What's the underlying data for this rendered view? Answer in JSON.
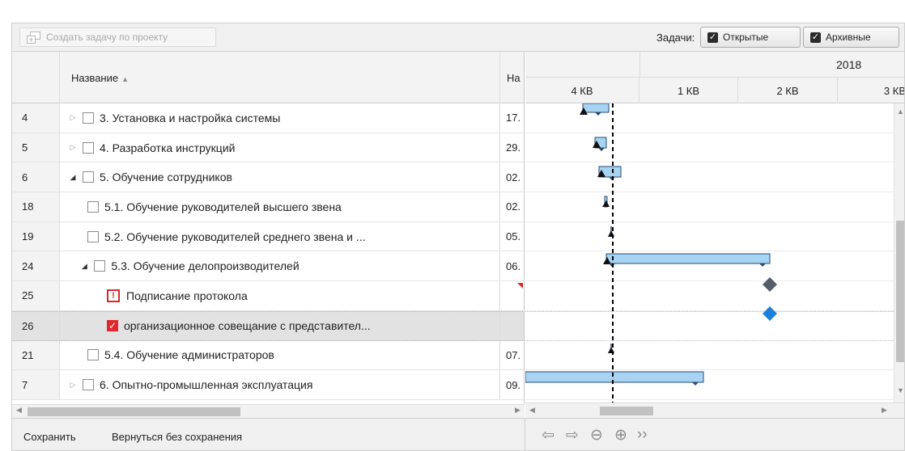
{
  "toolbar": {
    "create_task_label": "Создать задачу по проекту",
    "tasks_label": "Задачи:",
    "open_label": "Открытые",
    "archive_label": "Архивные"
  },
  "grid": {
    "columns": {
      "name": "Название",
      "start": "На"
    },
    "rows": [
      {
        "num": "4",
        "indent": 1,
        "toggle": "collapsed",
        "marker": "checkbox",
        "name": "3. Установка и настройка системы",
        "start": "17."
      },
      {
        "num": "5",
        "indent": 1,
        "toggle": "collapsed",
        "marker": "checkbox",
        "name": "4. Разработка инструкций",
        "start": "29."
      },
      {
        "num": "6",
        "indent": 1,
        "toggle": "expanded",
        "marker": "checkbox",
        "name": "5. Обучение сотрудников",
        "start": "02."
      },
      {
        "num": "18",
        "indent": 2,
        "toggle": "none",
        "marker": "checkbox",
        "name": "5.1. Обучение руководителей высшего звена",
        "start": "02."
      },
      {
        "num": "19",
        "indent": 2,
        "toggle": "none",
        "marker": "checkbox",
        "name": "5.2. Обучение руководителей среднего звена и ...",
        "start": "05."
      },
      {
        "num": "24",
        "indent": 1.6,
        "toggle": "expanded",
        "marker": "checkbox",
        "name": "5.3. Обучение делопроизводителей",
        "start": "06."
      },
      {
        "num": "25",
        "indent": 3,
        "toggle": "none",
        "marker": "warning",
        "name": "Подписание протокола",
        "start": "",
        "flag": true
      },
      {
        "num": "26",
        "indent": 3,
        "toggle": "none",
        "marker": "checked",
        "name": "организационное совещание с представител...",
        "start": "",
        "selected": true
      },
      {
        "num": "21",
        "indent": 2,
        "toggle": "none",
        "marker": "checkbox",
        "name": "5.4. Обучение администраторов",
        "start": "07."
      },
      {
        "num": "7",
        "indent": 1,
        "toggle": "collapsed",
        "marker": "checkbox",
        "name": "6. Опытно-промышленная эксплуатация",
        "start": "09."
      }
    ]
  },
  "gantt": {
    "year": "2018",
    "quarters": [
      "4 КВ",
      "1 КВ",
      "2 КВ",
      "3 КВ"
    ],
    "colors": {
      "bar_fill": "#a6d4f2",
      "bar_stroke": "#2b4a73",
      "milestone": "#555d6b",
      "milestone_selected": "#1b80d6",
      "today_line": "#000000"
    }
  },
  "bottom": {
    "save_label": "Сохранить",
    "back_label": "Вернуться без сохранения",
    "nav": {
      "prev": "⇦",
      "next": "⇨",
      "zoom_out": "⊖",
      "zoom_in": "⊕",
      "more": "››"
    }
  }
}
